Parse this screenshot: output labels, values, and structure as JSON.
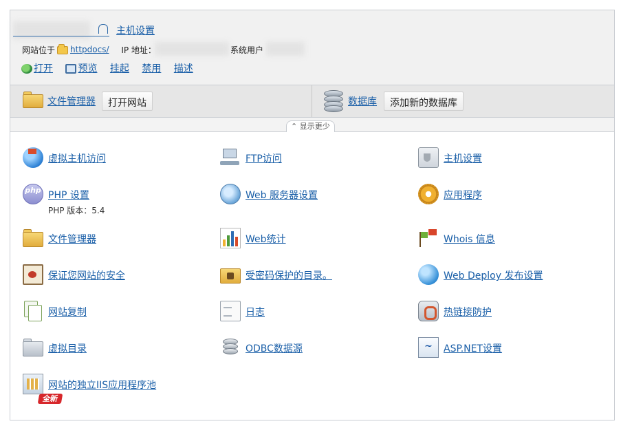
{
  "header": {
    "host_settings_link": "主机设置",
    "site_location_label": "网站位于",
    "site_folder": "httpdocs/",
    "ip_label": "IP 地址：",
    "system_user_label": "系统用户",
    "actions": [
      {
        "label": "打开",
        "icon": "open-globe-icon"
      },
      {
        "label": "预览",
        "icon": "preview-icon"
      },
      {
        "label": "挂起"
      },
      {
        "label": "禁用"
      },
      {
        "label": "描述"
      }
    ]
  },
  "toolbar": {
    "file_manager_link": "文件管理器",
    "open_site_button": "打开网站",
    "database_link": "数据库",
    "add_database_button": "添加新的数据库"
  },
  "show_less": "显示更少",
  "features": {
    "col1": [
      {
        "label": "虚拟主机访问",
        "icon": "globe-flag-icon"
      },
      {
        "label": "PHP 设置",
        "icon": "php-icon",
        "sub": "PHP 版本：5.4"
      },
      {
        "label": "文件管理器",
        "icon": "folder-icon"
      },
      {
        "label": "保证您网站的安全",
        "icon": "certificate-icon"
      },
      {
        "label": "网站复制",
        "icon": "copy-documents-icon"
      },
      {
        "label": "虚拟目录",
        "icon": "grey-folder-icon"
      },
      {
        "label": "网站的独立IIS应用程序池",
        "icon": "iis-pool-icon"
      }
    ],
    "col2": [
      {
        "label": "FTP访问",
        "icon": "ftp-icon"
      },
      {
        "label": "Web 服务器设置",
        "icon": "web-server-icon"
      },
      {
        "label": "Web统计",
        "icon": "bar-chart-icon"
      },
      {
        "label": "受密码保护的目录。",
        "icon": "locked-folder-icon"
      },
      {
        "label": "日志",
        "icon": "log-page-icon"
      },
      {
        "label": "ODBC数据源",
        "icon": "odbc-database-icon"
      }
    ],
    "col3": [
      {
        "label": "主机设置",
        "icon": "host-settings-icon"
      },
      {
        "label": "应用程序",
        "icon": "gear-icon"
      },
      {
        "label": "Whois 信息",
        "icon": "whois-flags-icon"
      },
      {
        "label": "Web Deploy 发布设置",
        "icon": "web-deploy-icon"
      },
      {
        "label": "热链接防护",
        "icon": "hotlink-shield-icon"
      },
      {
        "label": "ASP.NET设置",
        "icon": "aspnet-icon"
      }
    ]
  },
  "new_badge": "全新",
  "colors": {
    "link": "#1a5fa8",
    "badge": "#d7272b"
  }
}
